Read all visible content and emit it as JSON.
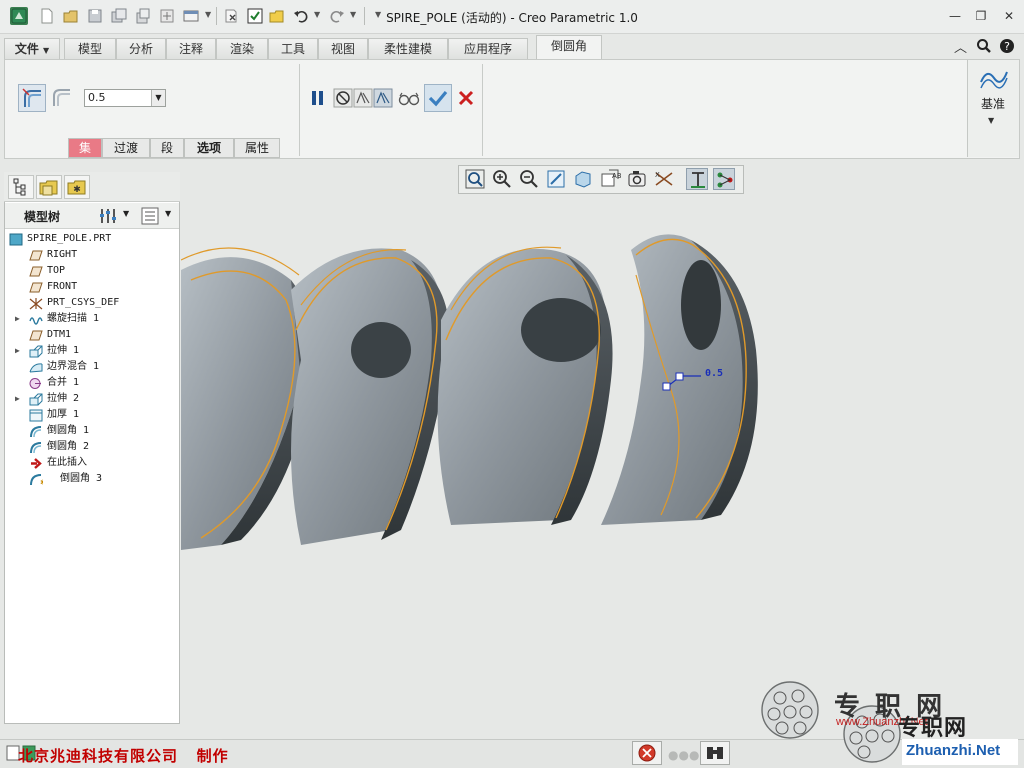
{
  "window": {
    "title": "SPIRE_POLE (活动的) - Creo Parametric 1.0",
    "controls": {
      "minimize": "—",
      "restore": "❐",
      "close": "✕"
    }
  },
  "quick_access": {
    "icons": [
      "app-icon",
      "new-icon",
      "open-icon",
      "save-icon",
      "save-copy-icon",
      "regenerate-icon",
      "mapkey-icon",
      "windows-icon",
      "close-window-icon",
      "select-icon",
      "folder-icon",
      "undo-icon",
      "redo-icon",
      "customize-icon"
    ]
  },
  "menu_tabs": [
    {
      "label": "文件"
    },
    {
      "label": "模型"
    },
    {
      "label": "分析"
    },
    {
      "label": "注释"
    },
    {
      "label": "渲染"
    },
    {
      "label": "工具"
    },
    {
      "label": "视图"
    },
    {
      "label": "柔性建模"
    },
    {
      "label": "应用程序"
    },
    {
      "label": "倒圆角"
    }
  ],
  "ribbon": {
    "radius_value": "0.5",
    "sub_tabs": [
      {
        "label": "集"
      },
      {
        "label": "过渡"
      },
      {
        "label": "段"
      },
      {
        "label": "选项"
      },
      {
        "label": "属性"
      }
    ],
    "datum_label": "基准"
  },
  "model_tree": {
    "title": "模型树",
    "items": [
      {
        "label": "SPIRE_POLE.PRT",
        "icon": "part-icon",
        "expandable": false
      },
      {
        "label": "RIGHT",
        "icon": "datum-plane-icon",
        "expandable": false
      },
      {
        "label": "TOP",
        "icon": "datum-plane-icon",
        "expandable": false
      },
      {
        "label": "FRONT",
        "icon": "datum-plane-icon",
        "expandable": false
      },
      {
        "label": "PRT_CSYS_DEF",
        "icon": "csys-icon",
        "expandable": false
      },
      {
        "label": "螺旋扫描 1",
        "icon": "helical-sweep-icon",
        "expandable": true
      },
      {
        "label": "DTM1",
        "icon": "datum-plane-icon",
        "expandable": false
      },
      {
        "label": "拉伸 1",
        "icon": "extrude-icon",
        "expandable": true
      },
      {
        "label": "边界混合 1",
        "icon": "boundary-blend-icon",
        "expandable": false
      },
      {
        "label": "合并 1",
        "icon": "merge-icon",
        "expandable": false
      },
      {
        "label": "拉伸 2",
        "icon": "extrude-icon",
        "expandable": true
      },
      {
        "label": "加厚 1",
        "icon": "thicken-icon",
        "expandable": false
      },
      {
        "label": "倒圆角 1",
        "icon": "round-icon",
        "expandable": false
      },
      {
        "label": "倒圆角 2",
        "icon": "round-icon",
        "expandable": false
      },
      {
        "label": "在此插入",
        "icon": "insert-here-icon",
        "expandable": false
      },
      {
        "label": "倒圆角 3",
        "icon": "round-new-icon",
        "expandable": false
      }
    ]
  },
  "graphics": {
    "dimension_label": "0.5",
    "model_color": "#9aa3a9",
    "edge_color": "#e09a2a"
  },
  "status": {
    "text": "北京兆迪科技有限公司   制作"
  },
  "watermark": {
    "brand_cn": "专 职 网",
    "brand_cn2": "专职网",
    "url": "Zhuanzhi.Net",
    "url_small": "www.Zhuanzhi.Net"
  }
}
